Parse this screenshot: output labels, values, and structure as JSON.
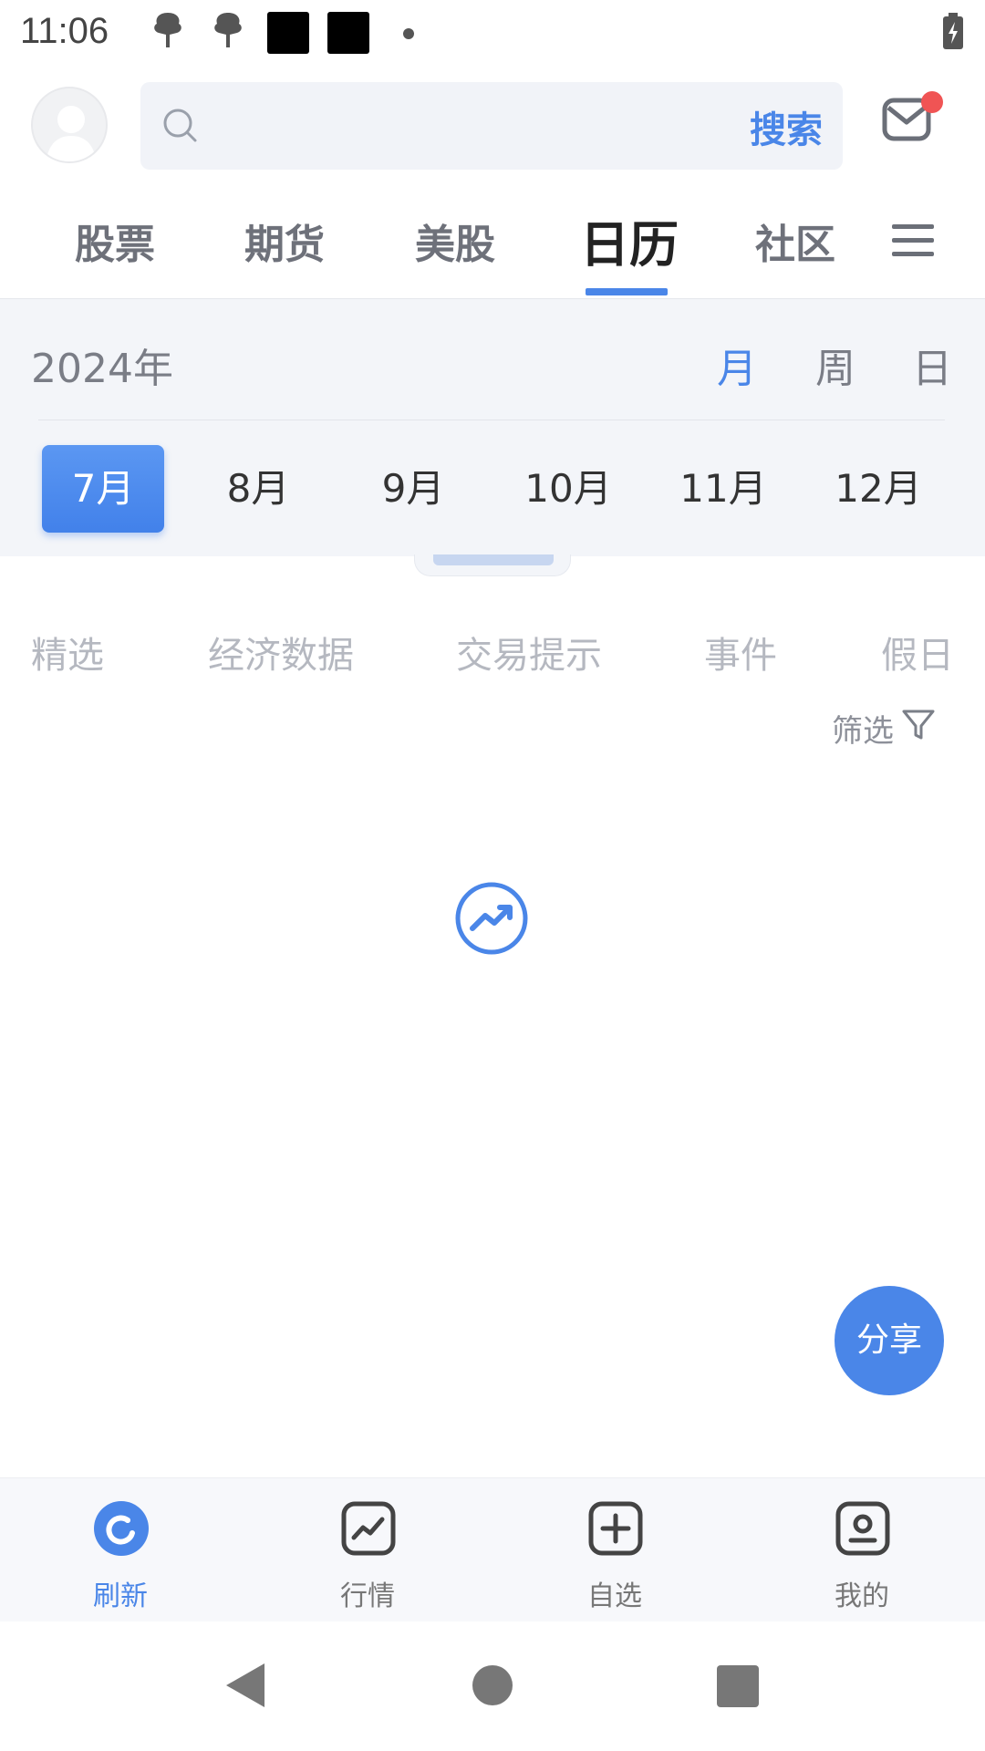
{
  "status_bar": {
    "time": "11:06"
  },
  "search": {
    "placeholder": "",
    "button_label": "搜索"
  },
  "top_tabs": [
    "股票",
    "期货",
    "美股",
    "日历",
    "社区"
  ],
  "calendar": {
    "year_label": "2024年",
    "modes": [
      "月",
      "周",
      "日"
    ],
    "months": [
      "7月",
      "8月",
      "9月",
      "10月",
      "11月",
      "12月"
    ]
  },
  "categories": [
    "精选",
    "经济数据",
    "交易提示",
    "事件",
    "假日"
  ],
  "filter_label": "筛选",
  "share_label": "分享",
  "bottom_nav": [
    "刷新",
    "行情",
    "自选",
    "我的"
  ],
  "colors": {
    "accent": "#4a86e8",
    "badge": "#f05454"
  }
}
